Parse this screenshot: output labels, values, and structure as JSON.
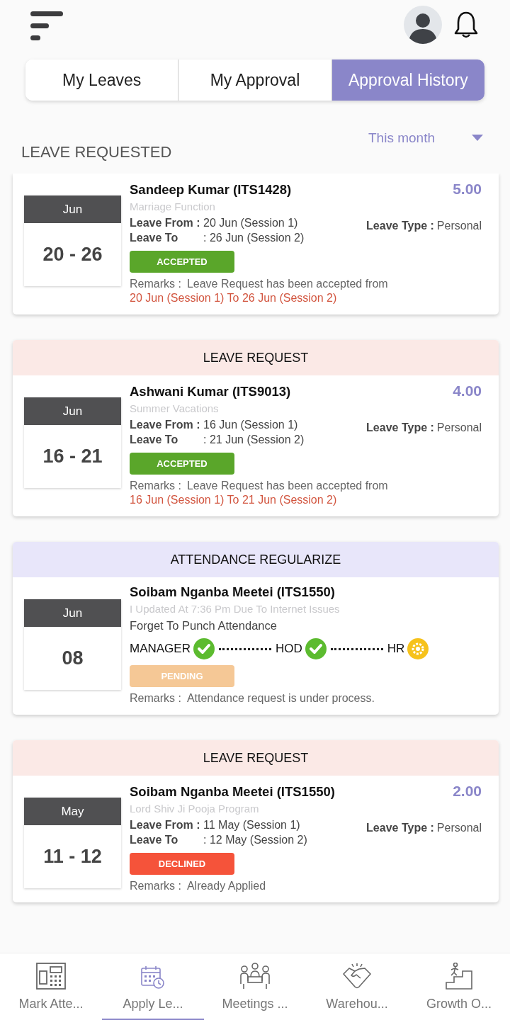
{
  "tabs": [
    {
      "label": "My Leaves",
      "selected": false
    },
    {
      "label": "My Approval",
      "selected": false
    },
    {
      "label": "Approval History",
      "selected": true
    }
  ],
  "section_title": "LEAVE REQUESTED",
  "filter": {
    "value": "This month"
  },
  "cards": [
    {
      "kind": "leave",
      "month": "Jun",
      "days": "20 - 26",
      "name": "Sandeep Kumar (ITS1428)",
      "amount": "5.00",
      "reason": "Marriage Function",
      "from_label": "Leave From :",
      "from": "20 Jun (Session 1)",
      "to_label": "Leave To",
      "to": ": 26 Jun (Session 2)",
      "type_label": "Leave Type :",
      "type": "Personal",
      "color": "#5aa62a",
      "status_label": "ACCEPTED",
      "remarks_label": "Remarks :",
      "remarks": "Leave Request has been accepted from",
      "remarks_detail": "20 Jun (Session 1) To 26 Jun (Session 2)"
    },
    {
      "kind": "leave",
      "header": "LEAVE REQUEST",
      "month": "Jun",
      "days": "16 - 21",
      "name": "Ashwani Kumar (ITS9013)",
      "amount": "4.00",
      "reason": "Summer Vacations",
      "from_label": "Leave From :",
      "from": "16 Jun (Session 1)",
      "to_label": "Leave To",
      "to": ": 21 Jun (Session 2)",
      "type_label": "Leave Type :",
      "type": "Personal",
      "color": "#5aa62a",
      "status_label": "ACCEPTED",
      "remarks_label": "Remarks :",
      "remarks": "Leave Request has been accepted from",
      "remarks_detail": "16 Jun (Session 1) To 21 Jun (Session 2)"
    },
    {
      "kind": "attendance",
      "header": "ATTENDANCE REGULARIZE",
      "month": "Jun",
      "days": "08",
      "name": "Soibam Nganba Meetei (ITS1550)",
      "reason": "I Updated At 7:36 Pm Due To Internet Issues",
      "detail": "Forget To Punch Attendance",
      "steps": [
        {
          "label": "MANAGER",
          "done": true
        },
        {
          "label": "HOD",
          "done": true
        },
        {
          "label": "HR",
          "done": false
        }
      ],
      "color": "#f5c896",
      "status_label": "PENDING",
      "remarks_label": "Remarks :",
      "remarks": "Attendance request is under process."
    },
    {
      "kind": "leave",
      "header": "LEAVE REQUEST",
      "month": "May",
      "days": "11 - 12",
      "name": "Soibam Nganba Meetei (ITS1550)",
      "amount": "2.00",
      "reason": "Lord Shiv Ji Pooja Program",
      "from_label": "Leave From :",
      "from": "11 May (Session 1)",
      "to_label": "Leave To",
      "to": ": 12 May (Session 2)",
      "type_label": "Leave Type :",
      "type": "Personal",
      "color": "#f5533a",
      "status_label": "DECLINED",
      "remarks_label": "Remarks :",
      "remarks": "Already Applied"
    }
  ],
  "bottom_nav": [
    {
      "label": "Mark Atte...",
      "selected": false
    },
    {
      "label": "Apply Le...",
      "selected": true
    },
    {
      "label": "Meetings ...",
      "selected": false
    },
    {
      "label": "Warehou...",
      "selected": false
    },
    {
      "label": "Growth O...",
      "selected": false
    }
  ]
}
